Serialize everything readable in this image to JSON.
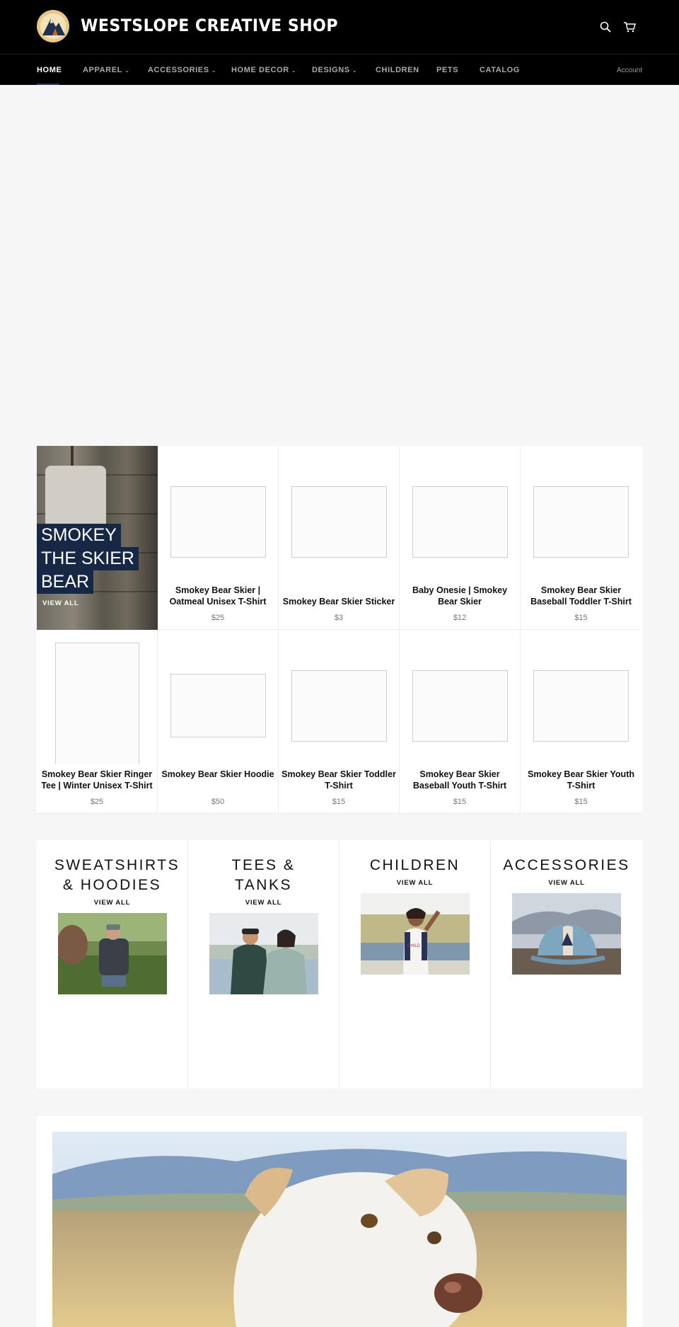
{
  "header": {
    "brand": "WESTSLOPE CREATIVE SHOP",
    "logo_icon": "mountain-logo-icon",
    "search_icon": "search-icon",
    "cart_icon": "cart-icon"
  },
  "nav": {
    "items": [
      {
        "label": "HOME",
        "dropdown": false
      },
      {
        "label": "APPAREL",
        "dropdown": true
      },
      {
        "label": "ACCESSORIES",
        "dropdown": true
      },
      {
        "label": "HOME DECOR",
        "dropdown": true
      },
      {
        "label": "DESIGNS",
        "dropdown": true
      },
      {
        "label": "CHILDREN",
        "dropdown": false
      },
      {
        "label": "PETS",
        "dropdown": false
      },
      {
        "label": "CATALOG",
        "dropdown": false
      }
    ],
    "chevron": "⌄",
    "account": "Account"
  },
  "featured_collection": {
    "title_lines": [
      "SMOKEY",
      "THE SKIER",
      "BEAR"
    ],
    "view_all": "VIEW ALL"
  },
  "products": [
    {
      "title": "Smokey Bear Skier | Oatmeal Unisex T-Shirt",
      "price": "$25"
    },
    {
      "title": "Smokey Bear Skier Sticker",
      "price": "$3"
    },
    {
      "title": "Baby Onesie | Smokey Bear Skier",
      "price": "$12"
    },
    {
      "title": "Smokey Bear Skier Baseball Toddler T-Shirt",
      "price": "$15"
    },
    {
      "title": "Smokey Bear Skier Ringer Tee | Winter Unisex T-Shirt",
      "price": "$25"
    },
    {
      "title": "Smokey Bear Skier Hoodie",
      "price": "$50"
    },
    {
      "title": "Smokey Bear Skier Toddler T-Shirt",
      "price": "$15"
    },
    {
      "title": "Smokey Bear Skier Baseball Youth T-Shirt",
      "price": "$15"
    },
    {
      "title": "Smokey Bear Skier Youth T-Shirt",
      "price": "$15"
    }
  ],
  "collections": [
    {
      "title_lines": [
        "SWEATSHIRTS",
        "& HOODIES"
      ],
      "view_all": "VIEW ALL"
    },
    {
      "title_lines": [
        "TEES &",
        "TANKS"
      ],
      "view_all": "VIEW ALL"
    },
    {
      "title_lines": [
        "CHILDREN"
      ],
      "view_all": "VIEW ALL"
    },
    {
      "title_lines": [
        "ACCESSORIES"
      ],
      "view_all": "VIEW ALL"
    }
  ],
  "colors": {
    "header_bg": "#000000",
    "accent_navy": "#172846",
    "page_bg": "#f6f6f6"
  }
}
